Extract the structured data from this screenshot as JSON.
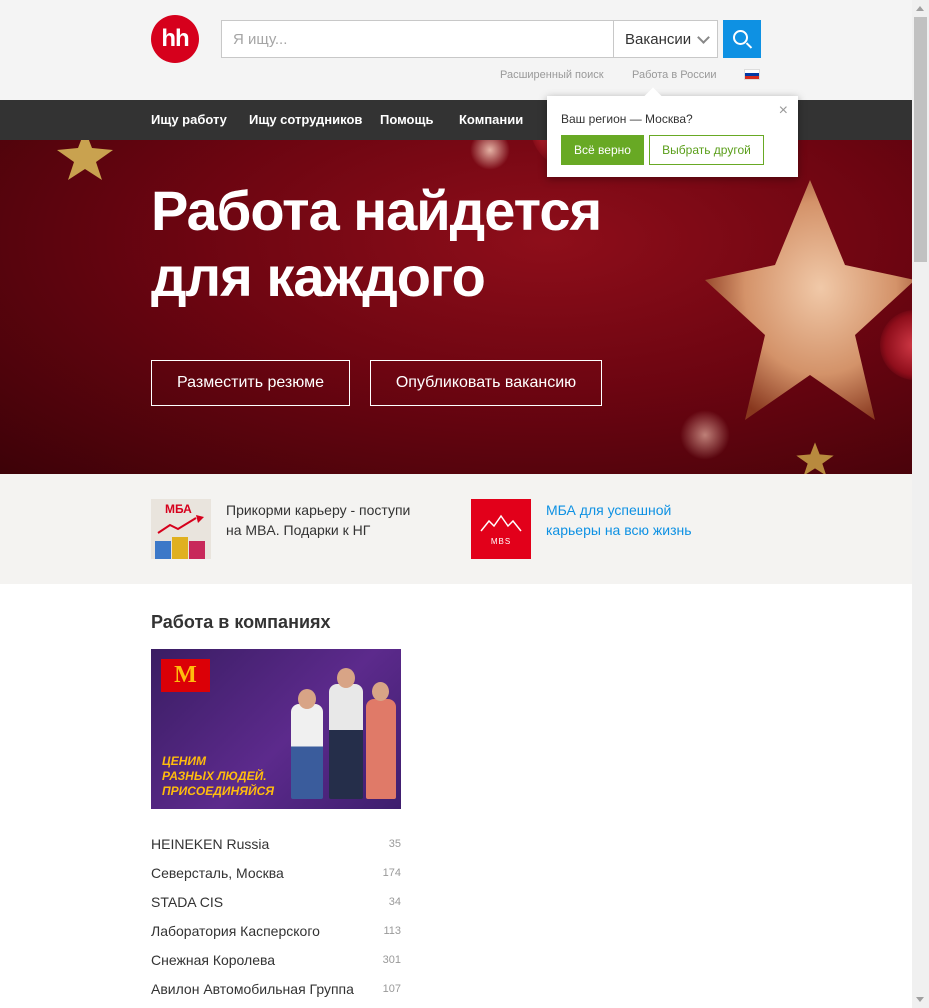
{
  "header": {
    "logo_text": "hh",
    "search_placeholder": "Я ищу...",
    "search_type": "Вакансии",
    "advanced_search": "Расширенный поиск",
    "work_in_russia": "Работа в России",
    "flag_colors": [
      "#ffffff",
      "#0039a6",
      "#d52b1e"
    ]
  },
  "nav": {
    "items": [
      "Ищу работу",
      "Ищу сотрудников",
      "Помощь",
      "Компании"
    ]
  },
  "hero": {
    "title_line1": "Работа найдется",
    "title_line2": "для каждого",
    "btn_resume": "Разместить резюме",
    "btn_vacancy": "Опубликовать вакансию"
  },
  "region_popup": {
    "question": "Ваш регион — Москва?",
    "confirm": "Всё верно",
    "change": "Выбрать другой",
    "close": "×"
  },
  "promo": {
    "item1_badge": "МБА",
    "item1_text": "Прикорми карьеру - поступи на MBA. Подарки к НГ",
    "item2_logo": "MBS",
    "item2_text": "МБА для успешной карьеры на всю жизнь"
  },
  "companies": {
    "title": "Работа в компаниях",
    "banner_text_1": "ЦЕНИМ",
    "banner_text_2": "РАЗНЫХ ЛЮДЕЙ.",
    "banner_text_3": "ПРИСОЕДИНЯЙСЯ",
    "banner_logo": "M",
    "list": [
      {
        "name": "HEINEKEN Russia",
        "count": "35"
      },
      {
        "name": "Северсталь, Москва",
        "count": "174"
      },
      {
        "name": "STADA CIS",
        "count": "34"
      },
      {
        "name": "Лаборатория Касперского",
        "count": "113"
      },
      {
        "name": "Снежная Королева",
        "count": "301"
      },
      {
        "name": "Авилон Автомобильная Группа",
        "count": "107"
      }
    ]
  },
  "colors": {
    "brand_red": "#d6001c",
    "search_blue": "#0e91e3",
    "nav_bg": "#333333",
    "confirm_green": "#68a924"
  }
}
